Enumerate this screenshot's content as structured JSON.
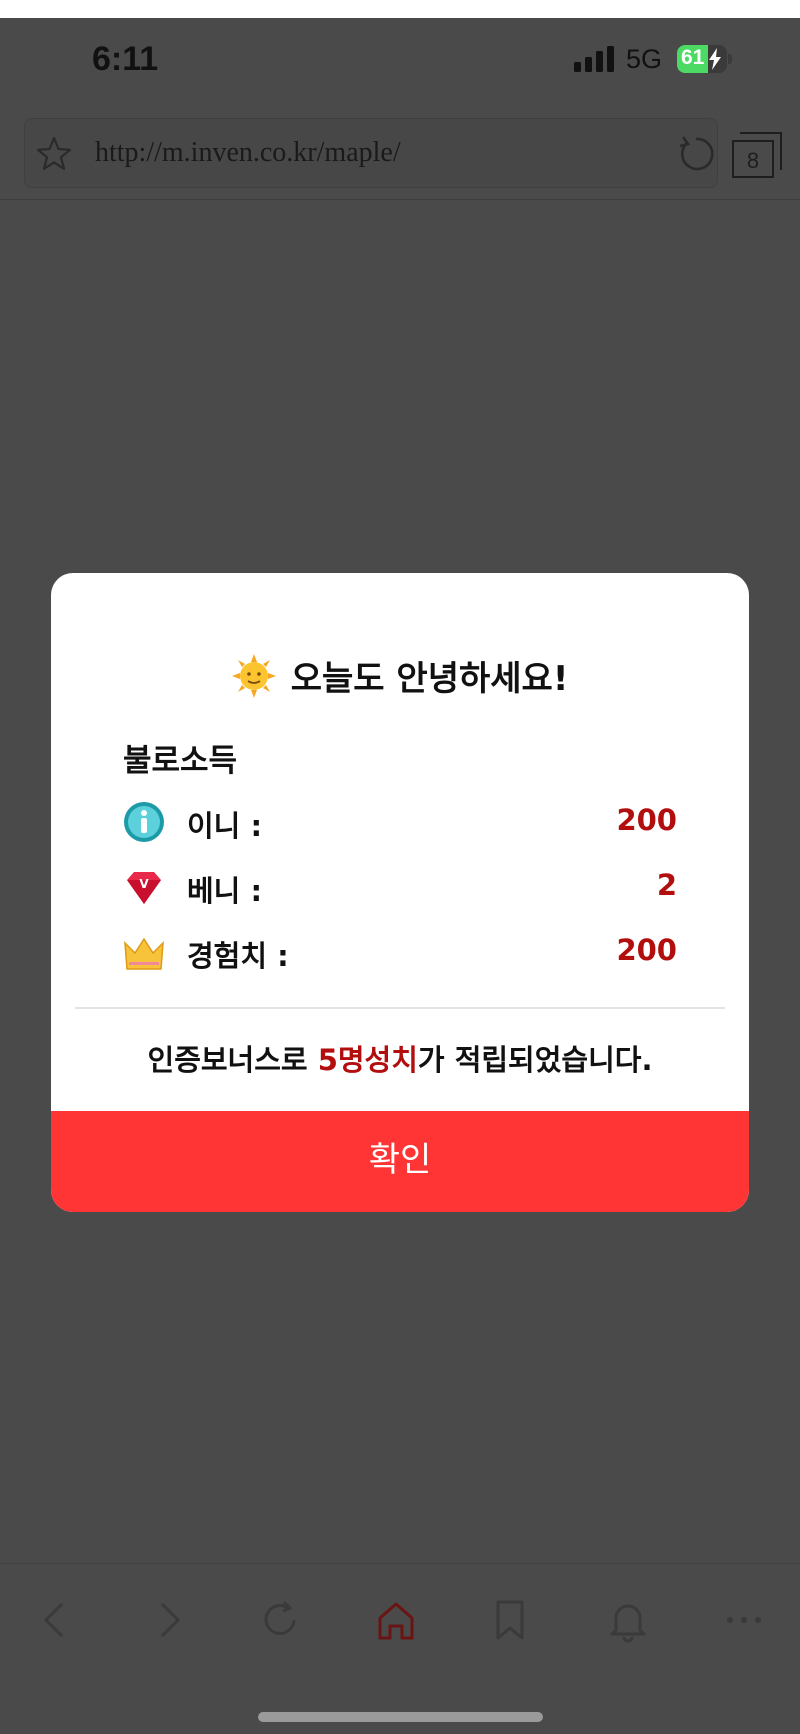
{
  "status_bar": {
    "time": "6:11",
    "network": "5G",
    "battery_percent": "61",
    "battery_level": 0.61,
    "battery_charging": true
  },
  "browser": {
    "url": "http://m.inven.co.kr/maple/",
    "tab_count": "8"
  },
  "modal": {
    "title": "오늘도 안녕하세요!",
    "title_icon": "sun-with-face-icon",
    "section_label": "불로소득",
    "rewards": [
      {
        "icon": "inni-coin-icon",
        "label": "이니 :",
        "value": "200"
      },
      {
        "icon": "benny-gem-icon",
        "label": "베니 :",
        "value": "2"
      },
      {
        "icon": "crown-icon",
        "label": "경험치 :",
        "value": "200"
      }
    ],
    "bonus_prefix": "인증보너스로 ",
    "bonus_highlight": "5명성치",
    "bonus_suffix": "가 적립되었습니다.",
    "confirm_label": "확인"
  },
  "bottom_nav": {
    "items": [
      "back-icon",
      "forward-icon",
      "refresh-icon",
      "home-icon",
      "bookmark-icon",
      "bell-icon",
      "more-icon"
    ]
  },
  "colors": {
    "accent": "#ff3535",
    "value_red": "#b30e0e",
    "overlay": "#4a4a4a"
  }
}
